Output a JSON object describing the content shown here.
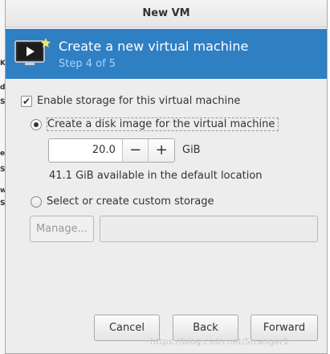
{
  "window": {
    "title": "New VM"
  },
  "banner": {
    "title": "Create a new virtual machine",
    "step": "Step 4 of 5"
  },
  "storage": {
    "enable_label": "Enable storage for this virtual machine",
    "enable_checked": true,
    "disk_image_label": "Create a disk image for the virtual machine",
    "disk_size": "20.0",
    "decrement_label": "−",
    "increment_label": "+",
    "unit": "GiB",
    "available_text": "41.1 GiB available in the default location",
    "custom_label": "Select or create custom storage",
    "manage_label": "Manage...",
    "custom_path": ""
  },
  "buttons": {
    "cancel": "Cancel",
    "back": "Back",
    "forward": "Forward"
  },
  "watermark": "https://blog.csdn.net/Stranger1",
  "colors": {
    "banner": "#2f7fc3",
    "step_text": "#a8d4ff",
    "dialog_bg": "#ededed"
  }
}
